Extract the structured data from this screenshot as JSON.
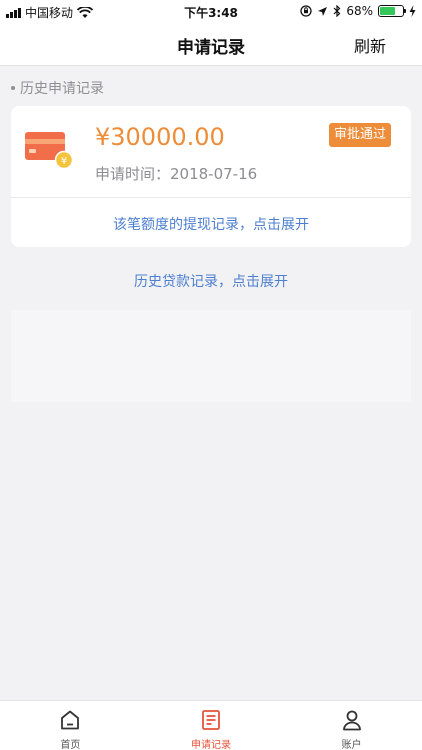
{
  "status_bar": {
    "carrier": "中国移动",
    "time": "下午3:48",
    "battery": "68%",
    "battery_level": 0.68,
    "icons": [
      "signal-icon",
      "wifi-icon",
      "lock-rotation-icon",
      "location-icon",
      "bluetooth-icon",
      "battery-icon",
      "charging-icon"
    ]
  },
  "nav": {
    "title": "申请记录",
    "refresh": "刷新"
  },
  "section": {
    "label": "历史申请记录"
  },
  "record": {
    "amount": "¥30000.00",
    "status": "审批通过",
    "apply_time": "申请时间：2018-07-16",
    "expand": "该笔额度的提现记录，点击展开",
    "icon": "credit-card-icon"
  },
  "loan_history": {
    "expand": "历史贷款记录，点击展开"
  },
  "tabs": [
    {
      "label": "首页",
      "icon": "home-icon",
      "active": false
    },
    {
      "label": "申请记录",
      "icon": "document-icon",
      "active": true
    },
    {
      "label": "账户",
      "icon": "user-icon",
      "active": false
    }
  ],
  "colors": {
    "accent": "#ee8d39",
    "link": "#4d7fd0",
    "tab_active": "#e8533a",
    "background": "#f2f2f4"
  }
}
